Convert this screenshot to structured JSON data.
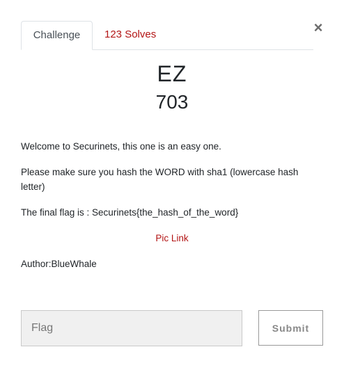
{
  "modal": {
    "close_symbol": "×",
    "tabs": [
      {
        "label": "Challenge",
        "active": true
      },
      {
        "label": "123 Solves",
        "active": false
      }
    ],
    "challenge": {
      "name": "EZ",
      "value": "703",
      "description": [
        "Welcome to Securinets, this one is an easy one.",
        "Please make sure you hash the WORD with sha1 (lowercase hash letter)",
        "The final flag is : Securinets{the_hash_of_the_word}"
      ],
      "link_text": "Pic Link",
      "author": "Author:BlueWhale"
    },
    "form": {
      "flag_placeholder": "Flag",
      "flag_value": "",
      "submit_label": "Submit"
    }
  },
  "colors": {
    "accent": "#b31515",
    "input_bg": "#f0f0f0"
  }
}
